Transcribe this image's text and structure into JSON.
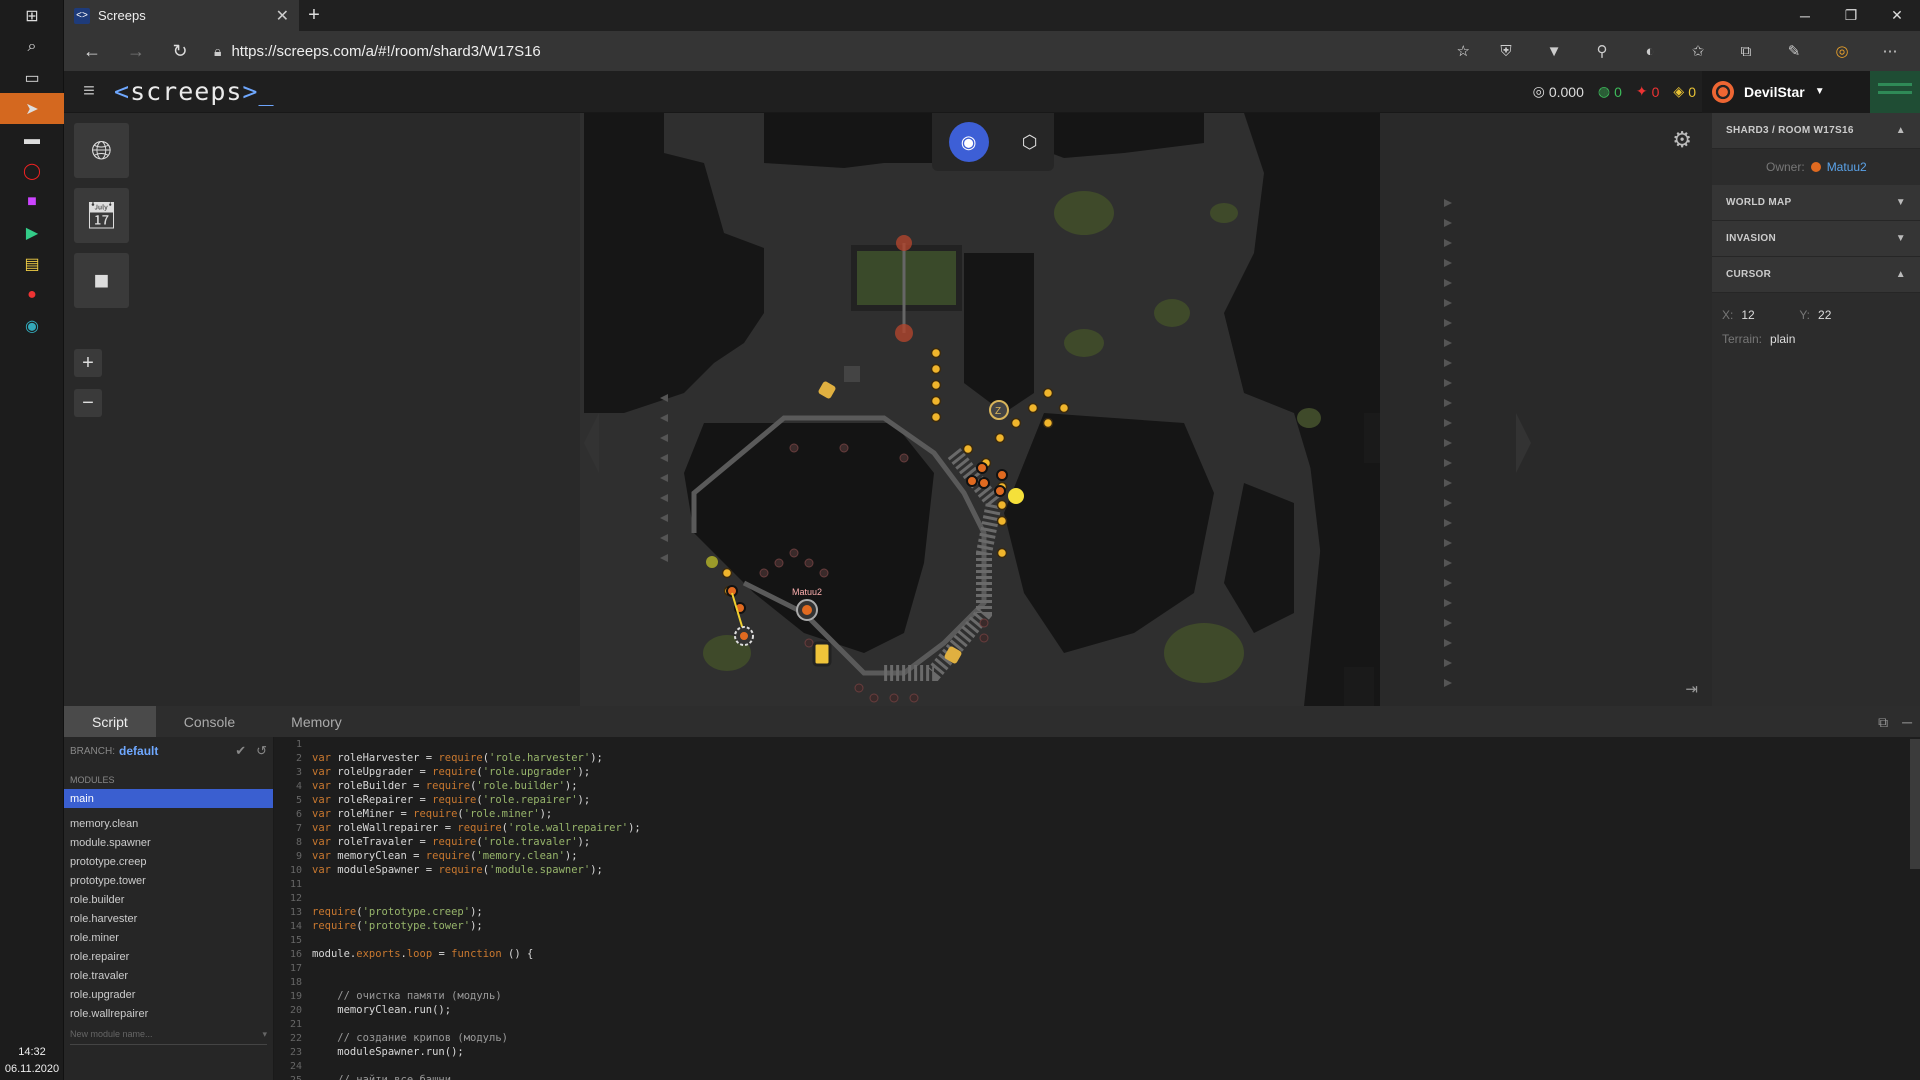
{
  "taskbar": {
    "icons": [
      "windows-start-icon",
      "search-icon",
      "task-view-icon",
      "telegram-icon",
      "terminal-icon",
      "opera-icon",
      "phpstorm-icon",
      "play-icon",
      "explorer-icon",
      "vivaldi-icon",
      "edge-icon"
    ],
    "time": "14:32",
    "date": "06.11.2020"
  },
  "browser": {
    "tab_title": "Screeps",
    "url": "https://screeps.com/a/#!/room/shard3/W17S16"
  },
  "header": {
    "logo": "screeps",
    "cpu": "0.000",
    "gcl": "0",
    "power": "0",
    "credits": "0",
    "username": "DevilStar"
  },
  "game": {
    "owner_label": "Matuu2",
    "view_mode": "eye"
  },
  "right_panel": {
    "room_section": "SHARD3 / ROOM W17S16",
    "owner_label": "Owner:",
    "owner_name": "Matuu2",
    "world_map": "WORLD MAP",
    "invasion": "INVASION",
    "cursor": "CURSOR",
    "x_label": "X:",
    "x_value": "12",
    "y_label": "Y:",
    "y_value": "22",
    "terrain_label": "Terrain:",
    "terrain_value": "plain"
  },
  "bottom": {
    "tabs": [
      "Script",
      "Console",
      "Memory"
    ],
    "branch_label": "BRANCH:",
    "branch_value": "default",
    "modules_label": "MODULES",
    "modules": [
      "main",
      "memory.clean",
      "module.spawner",
      "prototype.creep",
      "prototype.tower",
      "role.builder",
      "role.harvester",
      "role.miner",
      "role.repairer",
      "role.travaler",
      "role.upgrader",
      "role.wallrepairer"
    ],
    "new_module_placeholder": "New module name..."
  },
  "code_lines": [
    "",
    "var roleHarvester = require('role.harvester');",
    "var roleUpgrader = require('role.upgrader');",
    "var roleBuilder = require('role.builder');",
    "var roleRepairer = require('role.repairer');",
    "var roleMiner = require('role.miner');",
    "var roleWallrepairer = require('role.wallrepairer');",
    "var roleTravaler = require('role.travaler');",
    "var memoryClean = require('memory.clean');",
    "var moduleSpawner = require('module.spawner');",
    "",
    "",
    "require('prototype.creep');",
    "require('prototype.tower');",
    "",
    "module.exports.loop = function () {",
    "",
    "",
    "    // очистка памяти (модуль)",
    "    memoryClean.run();",
    "",
    "    // создание крипов (модуль)",
    "    moduleSpawner.run();",
    "",
    "    // найти все башни"
  ]
}
